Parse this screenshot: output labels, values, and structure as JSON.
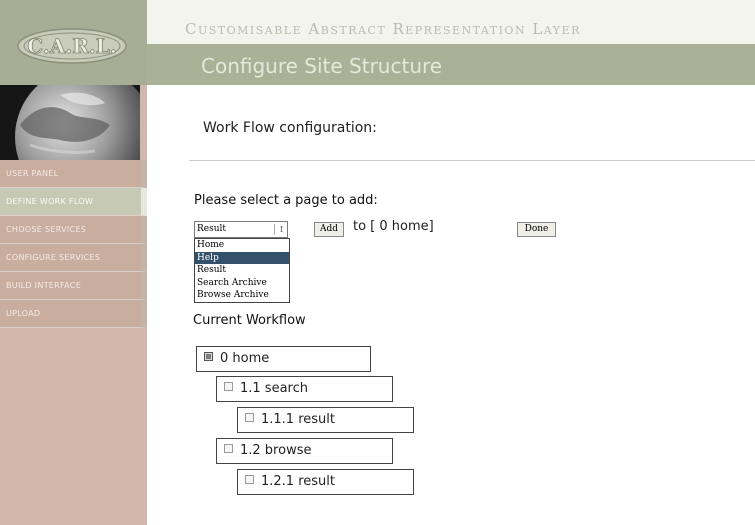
{
  "app": {
    "logo_text": "C.A.R.L.",
    "title": "Customisable Abstract Representation Layer",
    "page_heading": "Configure Site Structure"
  },
  "sidebar": {
    "items": [
      {
        "label": "User Panel",
        "active": false
      },
      {
        "label": "Define Work Flow",
        "active": true
      },
      {
        "label": "Choose Services",
        "active": false
      },
      {
        "label": "Configure Services",
        "active": false
      },
      {
        "label": "Build Interface",
        "active": false
      },
      {
        "label": "Upload",
        "active": false
      }
    ]
  },
  "main": {
    "section_title": "Work Flow configuration:",
    "select_prompt": "Please select a page to add:",
    "page_select": {
      "selected": "Result",
      "arrow": "↕",
      "options": [
        "Home",
        "Help",
        "Result",
        "Search Archive",
        "Browse Archive"
      ],
      "highlighted": "Help"
    },
    "add_label": "Add",
    "to_label": "to [ 0 home]",
    "done_label": "Done",
    "workflow_title": "Current Workflow",
    "workflow": [
      {
        "label": "0 home",
        "selected": true
      },
      {
        "label": "1.1 search",
        "selected": false
      },
      {
        "label": "1.1.1 result",
        "selected": false
      },
      {
        "label": "1.2 browse",
        "selected": false
      },
      {
        "label": "1.2.1 result",
        "selected": false
      }
    ]
  },
  "colors": {
    "header_band": "#aab197",
    "sidebar": "#cfb7ab",
    "sidebar_active": "#c6cab4",
    "dropdown_highlight": "#33516b"
  }
}
